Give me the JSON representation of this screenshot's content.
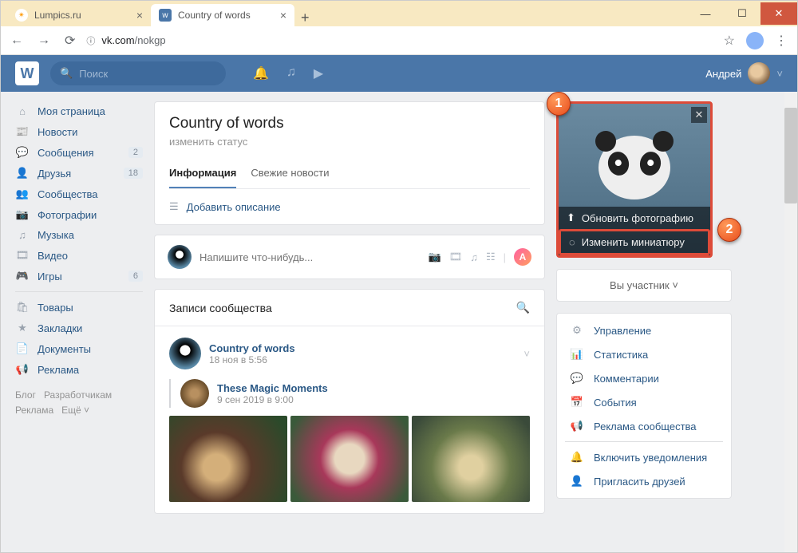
{
  "browser": {
    "tabs": [
      {
        "title": "Lumpics.ru",
        "active": false
      },
      {
        "title": "Country of words",
        "active": true
      }
    ],
    "url_host": "vk.com",
    "url_path": "/nokgp"
  },
  "header": {
    "search_placeholder": "Поиск",
    "username": "Андрей"
  },
  "sidebar": {
    "items": [
      {
        "icon": "home",
        "label": "Моя страница"
      },
      {
        "icon": "feed",
        "label": "Новости"
      },
      {
        "icon": "msg",
        "label": "Сообщения",
        "badge": "2"
      },
      {
        "icon": "friends",
        "label": "Друзья",
        "badge": "18"
      },
      {
        "icon": "groups",
        "label": "Сообщества"
      },
      {
        "icon": "photo",
        "label": "Фотографии"
      },
      {
        "icon": "music",
        "label": "Музыка"
      },
      {
        "icon": "video",
        "label": "Видео"
      },
      {
        "icon": "games",
        "label": "Игры",
        "badge": "6"
      }
    ],
    "items2": [
      {
        "icon": "market",
        "label": "Товары"
      },
      {
        "icon": "bookmark",
        "label": "Закладки"
      },
      {
        "icon": "docs",
        "label": "Документы"
      },
      {
        "icon": "ads",
        "label": "Реклама"
      }
    ],
    "footer": {
      "a": "Блог",
      "b": "Разработчикам",
      "c": "Реклама",
      "d": "Ещё ˅"
    }
  },
  "group": {
    "title": "Country of words",
    "change_status": "изменить статус",
    "tab_info": "Информация",
    "tab_news": "Свежие новости",
    "add_desc": "Добавить описание"
  },
  "composer": {
    "placeholder": "Напишите что-нибудь..."
  },
  "wall": {
    "header": "Записи сообщества",
    "post": {
      "name": "Country of words",
      "date": "18 ноя в 5:56"
    },
    "repost": {
      "name": "These Magic Moments",
      "date": "9 сен 2019 в 9:00"
    }
  },
  "avatar": {
    "update_photo": "Обновить фотографию",
    "change_thumb": "Изменить миниатюру"
  },
  "member_status": "Вы участник ˅",
  "mgmt": {
    "items": [
      {
        "icon": "gear",
        "label": "Управление"
      },
      {
        "icon": "stats",
        "label": "Статистика"
      },
      {
        "icon": "comments",
        "label": "Комментарии"
      },
      {
        "icon": "events",
        "label": "События"
      },
      {
        "icon": "megaphone",
        "label": "Реклама сообщества"
      },
      {
        "icon": "bell",
        "label": "Включить уведомления"
      },
      {
        "icon": "invite",
        "label": "Пригласить друзей"
      }
    ]
  },
  "callouts": {
    "c1": "1",
    "c2": "2"
  }
}
